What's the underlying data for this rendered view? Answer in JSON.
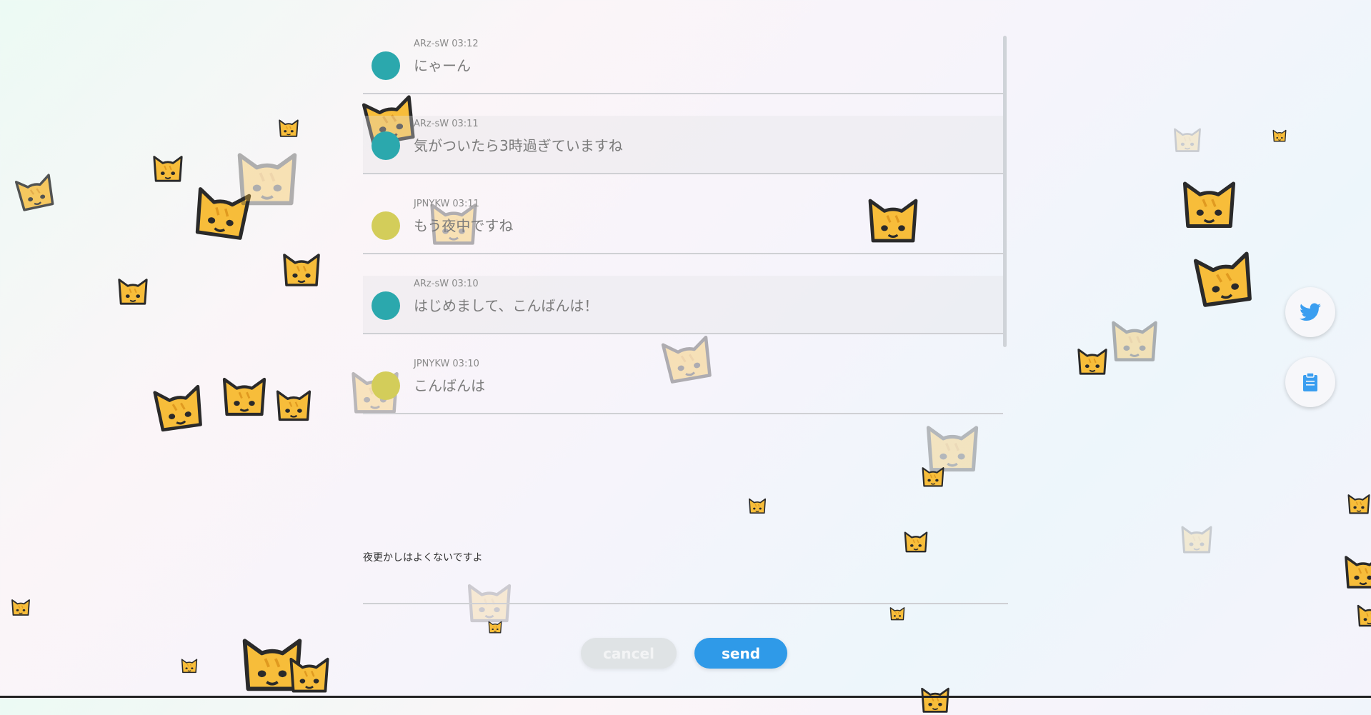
{
  "messages": [
    {
      "name": "ARz-sW",
      "time": "03:12",
      "text": "にゃーん",
      "color": "#2ba8ad"
    },
    {
      "name": "ARz-sW",
      "time": "03:11",
      "text": "気がついたら3時過ぎていますね",
      "color": "#2ba8ad"
    },
    {
      "name": "JPNYKW",
      "time": "03:11",
      "text": "もう夜中ですね",
      "color": "#d3cd5a"
    },
    {
      "name": "ARz-sW",
      "time": "03:10",
      "text": "はじめまして、こんばんは！",
      "color": "#2ba8ad"
    },
    {
      "name": "JPNYKW",
      "time": "03:10",
      "text": "こんばんは",
      "color": "#d3cd5a"
    }
  ],
  "input": {
    "value": "夜更かしはよくないですよ"
  },
  "buttons": {
    "cancel": "cancel",
    "send": "send"
  },
  "side": {
    "twitter_icon": "twitter-icon",
    "clipboard_icon": "clipboard-icon"
  },
  "colors": {
    "accent": "#2f9ae8",
    "icon": "#3a9ef0"
  }
}
